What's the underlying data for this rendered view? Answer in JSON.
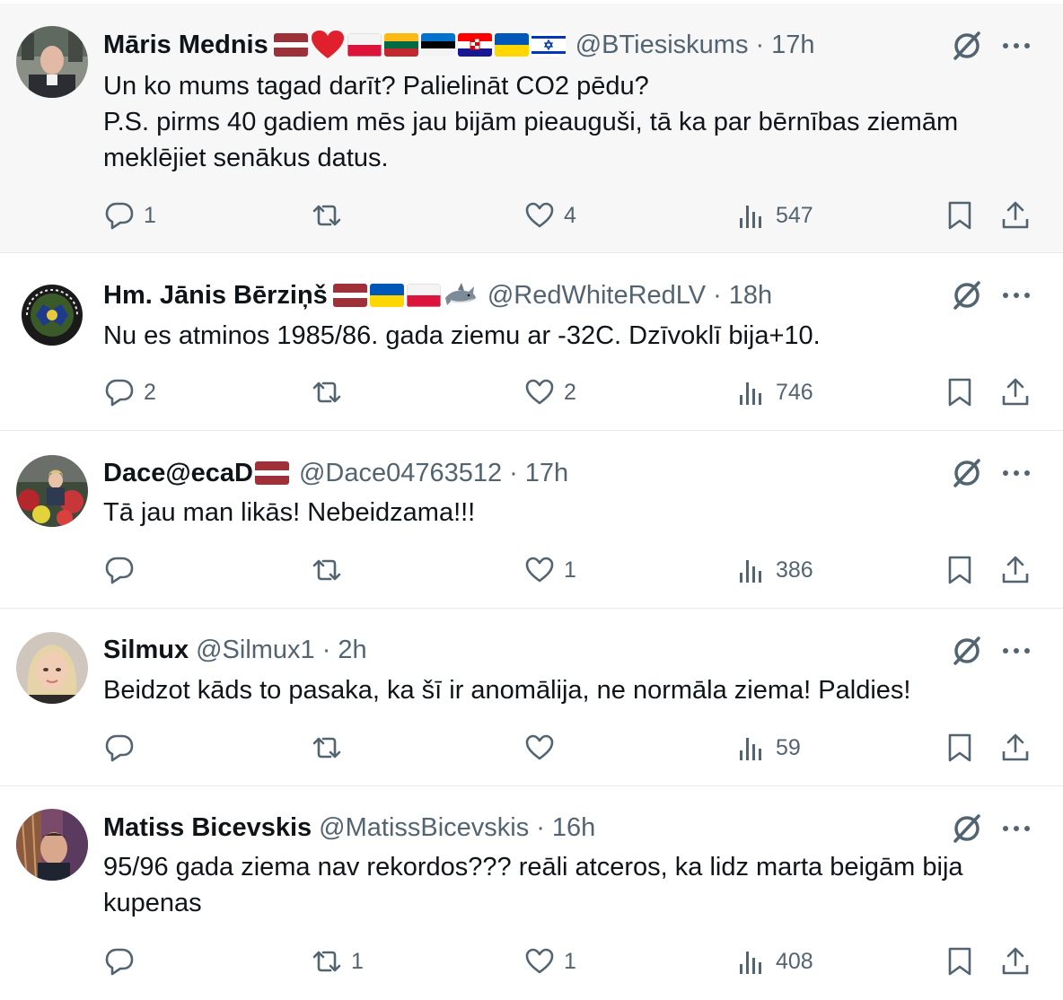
{
  "colors": {
    "text": "#0f1419",
    "secondary": "#536471",
    "divider": "#e6e9eb",
    "highlight": "#f7f7f7"
  },
  "icons": {
    "reply": "speech-bubble-icon",
    "repost": "repost-arrows-icon",
    "like": "heart-icon",
    "views": "bar-chart-icon",
    "bookmark": "bookmark-icon",
    "share": "share-upload-icon",
    "grok": "grok-slash-icon",
    "more": "ellipsis-icon"
  },
  "tweets": [
    {
      "name": "Māris Mednis",
      "handle": "@BTiesiskums",
      "time": "17h",
      "flags": [
        "latvia",
        "red-heart",
        "poland",
        "lithuania",
        "estonia",
        "croatia",
        "ukraine",
        "israel"
      ],
      "text": "Un ko mums tagad darīt? Palielināt CO2 pēdu?\nP.S. pirms 40 gadiem mēs jau bijām pieauguši, tā ka par bērnības ziemām meklējiet senākus datus.",
      "replies": "1",
      "reposts": "",
      "likes": "4",
      "views": "547"
    },
    {
      "name": "Hm. Jānis Bērziņš",
      "handle": "@RedWhiteRedLV",
      "time": "18h",
      "flags": [
        "latvia",
        "ukraine",
        "poland",
        "shark"
      ],
      "text": "Nu es atminos 1985/86. gada ziemu ar -32C. Dzīvoklī bija+10.",
      "replies": "2",
      "reposts": "",
      "likes": "2",
      "views": "746"
    },
    {
      "name": "Dace@ecaD",
      "handle": "@Dace04763512",
      "time": "17h",
      "flags": [
        "latvia"
      ],
      "text": "Tā jau man likās! Nebeidzama!!!",
      "replies": "",
      "reposts": "",
      "likes": "1",
      "views": "386"
    },
    {
      "name": "Silmux",
      "handle": "@Silmux1",
      "time": "2h",
      "flags": [],
      "text": "Beidzot kāds to pasaka, ka šī ir anomālija, ne normāla ziema! Paldies!",
      "replies": "",
      "reposts": "",
      "likes": "",
      "views": "59"
    },
    {
      "name": "Matiss Bicevskis",
      "handle": "@MatissBicevskis",
      "time": "16h",
      "flags": [],
      "text": "95/96 gada ziema nav rekordos??? reāli atceros, ka lidz marta beigām bija kupenas",
      "replies": "",
      "reposts": "1",
      "likes": "1",
      "views": "408"
    }
  ]
}
